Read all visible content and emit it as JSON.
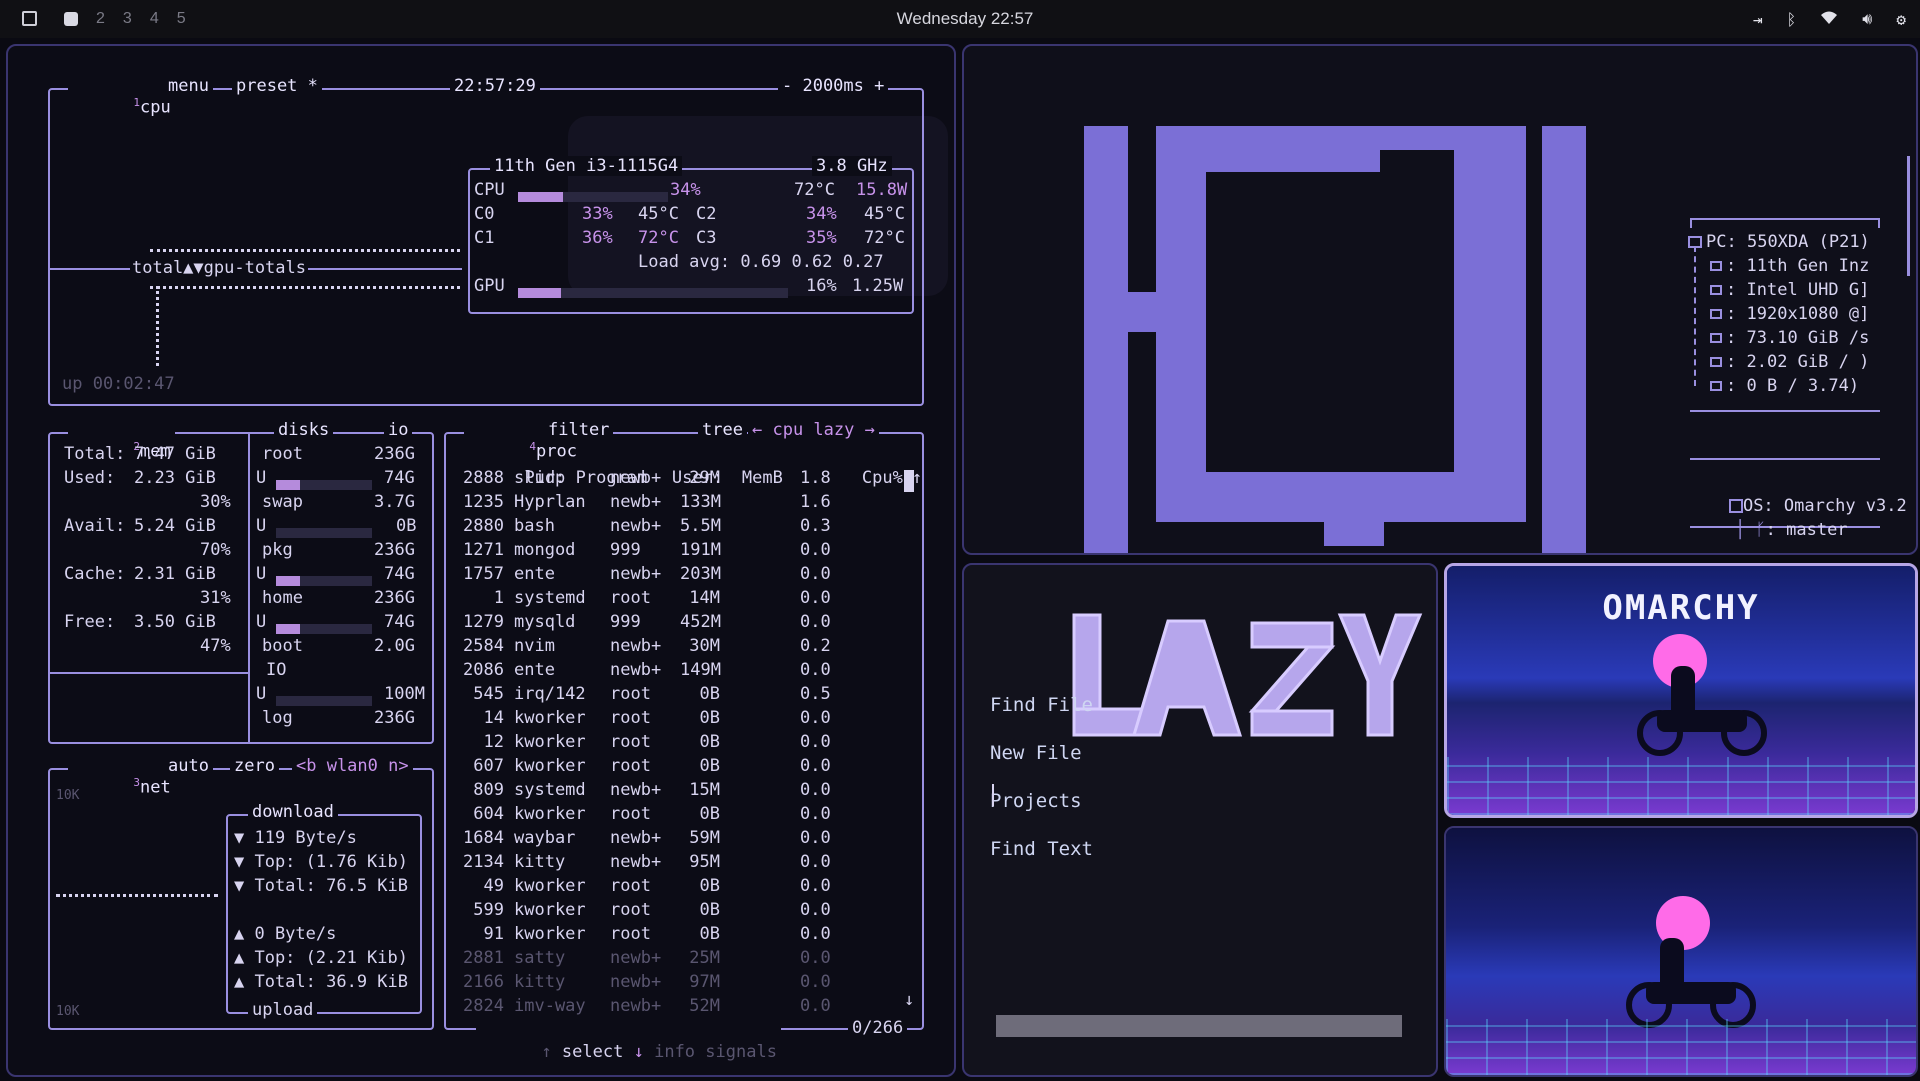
{
  "topbar": {
    "workspaces": [
      "2",
      "3",
      "4",
      "5"
    ],
    "clock": "Wednesday 22:57"
  },
  "colors": {
    "accent": "#c792ea",
    "frame": "#9a8fe0",
    "logo": "#7b6fd6",
    "bar_bg": "#101014"
  },
  "btop": {
    "cpu": {
      "tab": "cpu",
      "tab_num": "1",
      "menu": "menu",
      "preset": "preset *",
      "time": "22:57:29",
      "interval": "- 2000ms +",
      "cpu_name": "11th Gen i3-1115G4",
      "freq": "3.8 GHz",
      "total_row": {
        "label": "CPU",
        "pct": "34%",
        "temp": "72°C",
        "power": "15.8W",
        "fill": 0.34
      },
      "cores": [
        {
          "label": "C0",
          "pct": "33%",
          "temp": "45°C"
        },
        {
          "label": "C2",
          "pct": "34%",
          "temp": "45°C"
        },
        {
          "label": "C1",
          "pct": "36%",
          "temp": "72°C"
        },
        {
          "label": "C3",
          "pct": "35%",
          "temp": "72°C"
        }
      ],
      "load_avg": "Load avg: 0.69 0.62 0.27",
      "gpu_row": {
        "label": "GPU",
        "pct": "16%",
        "power": "1.25W",
        "fill": 0.16
      },
      "graph_label": "total▲▼gpu-totals",
      "uptime": "up 00:02:47"
    },
    "mem": {
      "tab": "mem",
      "tab_num": "2",
      "disks_tab": "disks",
      "io_tab": "io",
      "rows": [
        {
          "label": "Total:",
          "value": "7.47 GiB"
        },
        {
          "label": "Used:",
          "value": "2.23 GiB",
          "pct": "30%"
        },
        {
          "label": "Avail:",
          "value": "5.24 GiB",
          "pct": "70%"
        },
        {
          "label": "Cache:",
          "value": "2.31 GiB",
          "pct": "31%"
        },
        {
          "label": "Free:",
          "value": "3.50 GiB",
          "pct": "47%"
        }
      ],
      "disks": [
        {
          "name": "root",
          "size": "236G",
          "used": "74G",
          "fill": 0.31
        },
        {
          "name": "swap",
          "size": "3.7G",
          "used": "0B",
          "fill": 0.0
        },
        {
          "name": "pkg",
          "size": "236G",
          "used": "74G",
          "fill": 0.31
        },
        {
          "name": "home",
          "size": "236G",
          "used": "74G",
          "fill": 0.31
        },
        {
          "name": "boot",
          "size": "2.0G",
          "used": "",
          "fill": 0.0
        }
      ],
      "io_label": "IO",
      "io_value": "100M",
      "log": {
        "name": "log",
        "size": "236G"
      }
    },
    "net": {
      "tab": "net",
      "tab_num": "3",
      "auto": "auto",
      "zero": "zero",
      "iface": "<b wlan0 n>",
      "scale_top": "10K",
      "scale_bottom": "10K",
      "download_label": "download",
      "download": [
        "▼ 119 Byte/s",
        "▼ Top: (1.76 Kib)",
        "▼ Total: 76.5 KiB"
      ],
      "upload": [
        "▲ 0 Byte/s",
        "▲ Top: (2.21 Kib)",
        "▲ Total: 36.9 KiB"
      ],
      "upload_label": "upload"
    },
    "proc": {
      "tab": "proc",
      "tab_num": "4",
      "filter": "filter",
      "tree": "tree",
      "sort": "← cpu lazy →",
      "headers": [
        "Pid:",
        "Program",
        "User:",
        "MemB",
        "Cpu%"
      ],
      "rows": [
        [
          "2888",
          "slurp",
          "newb+",
          "29M",
          "1.8"
        ],
        [
          "1235",
          "Hyprlan",
          "newb+",
          "133M",
          "1.6"
        ],
        [
          "2880",
          "bash",
          "newb+",
          "5.5M",
          "0.3"
        ],
        [
          "1271",
          "mongod",
          "999",
          "191M",
          "0.0"
        ],
        [
          "1757",
          "ente",
          "newb+",
          "203M",
          "0.0"
        ],
        [
          "1",
          "systemd",
          "root",
          "14M",
          "0.0"
        ],
        [
          "1279",
          "mysqld",
          "999",
          "452M",
          "0.0"
        ],
        [
          "2584",
          "nvim",
          "newb+",
          "30M",
          "0.2"
        ],
        [
          "2086",
          "ente",
          "newb+",
          "149M",
          "0.0"
        ],
        [
          "545",
          "irq/142",
          "root",
          "0B",
          "0.5"
        ],
        [
          "14",
          "kworker",
          "root",
          "0B",
          "0.0"
        ],
        [
          "12",
          "kworker",
          "root",
          "0B",
          "0.0"
        ],
        [
          "607",
          "kworker",
          "root",
          "0B",
          "0.0"
        ],
        [
          "809",
          "systemd",
          "newb+",
          "15M",
          "0.0"
        ],
        [
          "604",
          "kworker",
          "root",
          "0B",
          "0.0"
        ],
        [
          "1684",
          "waybar",
          "newb+",
          "59M",
          "0.0"
        ],
        [
          "2134",
          "kitty",
          "newb+",
          "95M",
          "0.0"
        ],
        [
          "49",
          "kworker",
          "root",
          "0B",
          "0.0"
        ],
        [
          "599",
          "kworker",
          "root",
          "0B",
          "0.0"
        ],
        [
          "91",
          "kworker",
          "root",
          "0B",
          "0.0"
        ],
        [
          "2881",
          "satty",
          "newb+",
          "25M",
          "0.0"
        ],
        [
          "2166",
          "kitty",
          "newb+",
          "97M",
          "0.0"
        ],
        [
          "2824",
          "imv-way",
          "newb+",
          "52M",
          "0.0"
        ]
      ],
      "select": "select",
      "info": "info",
      "signals": "signals",
      "count": "0/266"
    }
  },
  "fastfetch": {
    "lines": [
      {
        "icon": "pc-icon",
        "key": "PC:",
        "value": "550XDA (P21)"
      },
      {
        "icon": "cpu-icon",
        "key": ":",
        "value": "11th Gen Inz"
      },
      {
        "icon": "gpu-icon",
        "key": ":",
        "value": "Intel UHD G]"
      },
      {
        "icon": "display-icon",
        "key": ":",
        "value": "1920x1080 @]"
      },
      {
        "icon": "disk-icon",
        "key": ":",
        "value": "73.10 GiB /s"
      },
      {
        "icon": "memory-icon",
        "key": ":",
        "value": "2.02 GiB / )"
      },
      {
        "icon": "swap-icon",
        "key": ":",
        "value": "0 B / 3.74)"
      }
    ],
    "os": {
      "key": "OS:",
      "value": "Omarchy v3.2"
    },
    "branch": {
      "key": ":",
      "value": "master"
    }
  },
  "nvim": {
    "logo": "LAZY",
    "menu": [
      "Find File",
      "New File",
      "Projects",
      "Find Text"
    ]
  },
  "wallpaper": {
    "title": "OMARCHY"
  }
}
